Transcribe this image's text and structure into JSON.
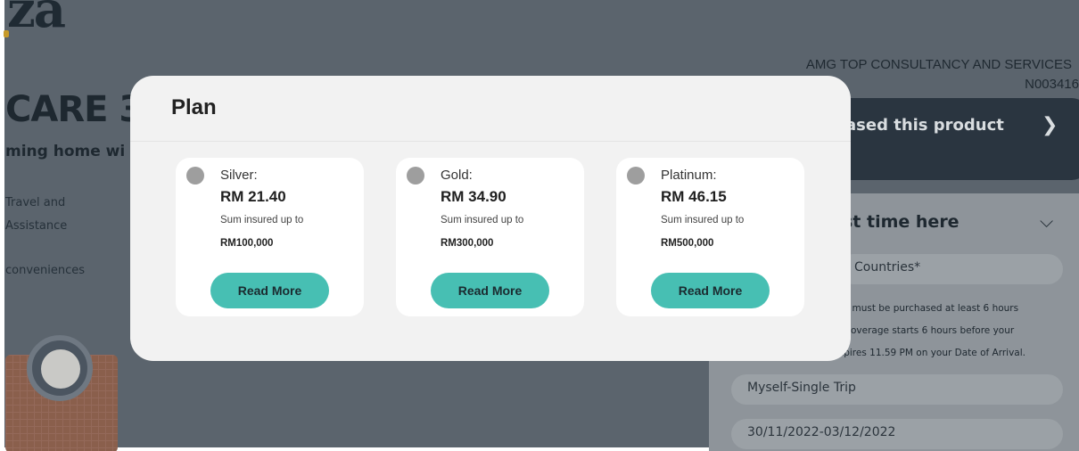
{
  "background": {
    "logo_text": "za",
    "product_title": "CARE 36",
    "subtitle": "ming home wi",
    "features": [
      "Travel and",
      "Assistance",
      "conveniences"
    ],
    "company_name": "AMG TOP CONSULTANCY AND SERVICES",
    "company_code": "N003416",
    "dark_card_text": "ased this product",
    "panel_title": "st time here",
    "countries_placeholder": "Countries*",
    "notes": [
      "ns must be purchased at least 6 hours",
      ". Coverage starts 6 hours before your",
      "xpires 11.59 PM on your Date of Arrival."
    ],
    "trip_type": "Myself-Single Trip",
    "date_range": "30/11/2022-03/12/2022"
  },
  "modal": {
    "title": "Plan",
    "plans": [
      {
        "name": "Silver:",
        "price": "RM 21.40",
        "sum_label": "Sum insured up to",
        "sum_value": "RM100,000",
        "button": "Read More"
      },
      {
        "name": "Gold:",
        "price": "RM 34.90",
        "sum_label": "Sum insured up to",
        "sum_value": "RM300,000",
        "button": "Read More"
      },
      {
        "name": "Platinum:",
        "price": "RM 46.15",
        "sum_label": "Sum insured up to",
        "sum_value": "RM500,000",
        "button": "Read More"
      }
    ]
  },
  "colors": {
    "overlay_bg": "#5b646d",
    "modal_bg": "#f2f2f2",
    "card_bg": "#ffffff",
    "radio": "#9e9e9e",
    "button_teal": "#47bfb3"
  }
}
